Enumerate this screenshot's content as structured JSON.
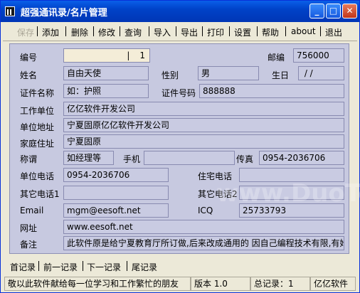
{
  "window": {
    "title": "超强通讯录/名片管理"
  },
  "menu": {
    "items": [
      {
        "label": "保存",
        "enabled": false
      },
      {
        "label": "添加",
        "enabled": true
      },
      {
        "label": "删除",
        "enabled": true
      },
      {
        "label": "修改",
        "enabled": true
      },
      {
        "label": "查询",
        "enabled": true
      },
      {
        "label": "导入",
        "enabled": true
      },
      {
        "label": "导出",
        "enabled": true
      },
      {
        "label": "打印",
        "enabled": true
      },
      {
        "label": "设置",
        "enabled": true
      },
      {
        "label": "帮助",
        "enabled": true
      },
      {
        "label": "about",
        "enabled": true
      },
      {
        "label": "退出",
        "enabled": true
      }
    ]
  },
  "form": {
    "id_label": "编号",
    "id_value": "1",
    "zip_label": "邮编",
    "zip_value": "756000",
    "name_label": "姓名",
    "name_value": "自由天使",
    "gender_label": "性别",
    "gender_value": "男",
    "birthday_label": "生日",
    "birthday_value": " / /",
    "idtype_label": "证件名称",
    "idtype_value": "如：护照",
    "idno_label": "证件号码",
    "idno_value": "888888",
    "company_label": "工作单位",
    "company_value": "亿亿软件开发公司",
    "company_addr_label": "单位地址",
    "company_addr_value": "宁夏固原亿亿软件开发公司",
    "home_addr_label": "家庭住址",
    "home_addr_value": "宁夏固原",
    "title_label": "称谓",
    "title_value": "如经理等",
    "mobile_label": "手机",
    "mobile_value": "",
    "fax_label": "传真",
    "fax_value": "0954-2036706",
    "work_phone_label": "单位电话",
    "work_phone_value": "0954-2036706",
    "home_phone_label": "住宅电话",
    "home_phone_value": "",
    "other_phone1_label": "其它电话1",
    "other_phone1_value": "",
    "other_phone2_label": "其它电话2",
    "other_phone2_value": "",
    "email_label": "Email",
    "email_value": "mgm@eesoft.net",
    "icq_label": "ICQ",
    "icq_value": "25733793",
    "web_label": "网址",
    "web_value": "www.eesoft.net",
    "note_label": "备注",
    "note_value": "此软件原是给宁夏教育厅所订做,后来改成通用的 因自己编程技术有限,有她"
  },
  "nav": {
    "first": "首记录",
    "prev": "前一记录",
    "next": "下一记录",
    "last": "尾记录"
  },
  "status": {
    "message": "敬以此软件献给每一位学习和工作繁忙的朋友",
    "version": "版本 1.0",
    "total": "总记录：1",
    "brand": "亿亿软件"
  },
  "watermark": {
    "text": "www.DuoTe.com"
  },
  "colors": {
    "titlebar": "#0a5fe8",
    "panel": "#c7c9e0",
    "window_bg": "#ece9d8"
  }
}
